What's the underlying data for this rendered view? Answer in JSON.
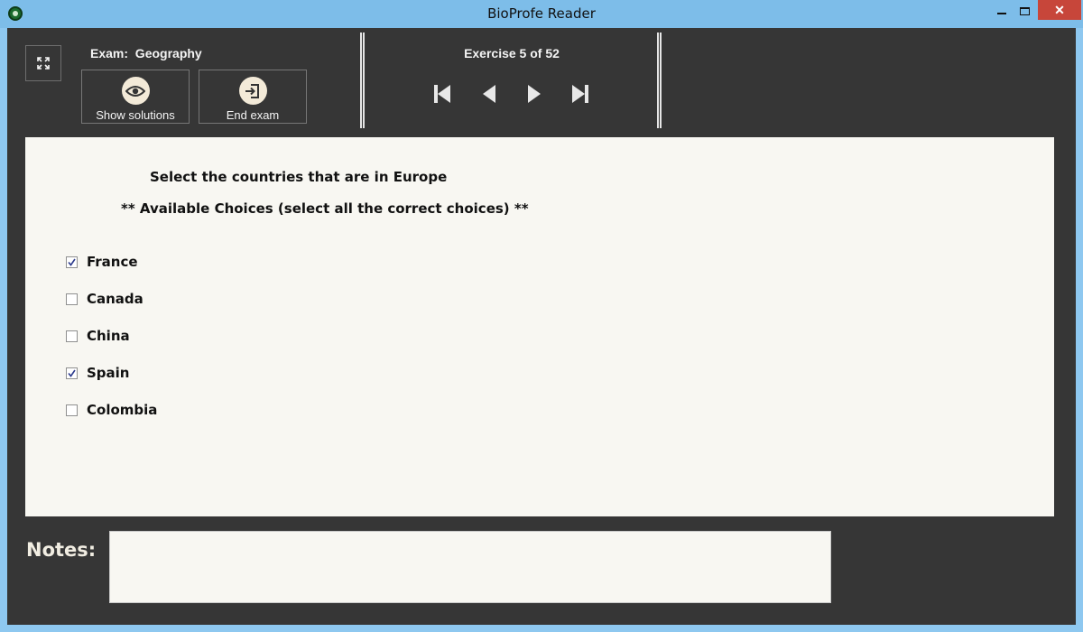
{
  "window": {
    "title": "BioProfe Reader",
    "close_glyph": "✕",
    "icons": [
      "app-icon",
      "minimize-icon",
      "maximize-icon",
      "close-icon"
    ]
  },
  "toolbar": {
    "exam_label": "Exam:  Geography",
    "show_solutions_label": "Show solutions",
    "end_exam_label": "End exam",
    "exercise_label": "Exercise 5 of 52",
    "icons": [
      "expand-icon",
      "eye-icon",
      "exit-door-icon",
      "first-icon",
      "prev-icon",
      "next-icon",
      "last-icon"
    ]
  },
  "question": {
    "title": "Select the countries that are in Europe",
    "instruction": "** Available Choices (select all the correct choices) **",
    "choices": [
      {
        "label": "France",
        "checked": true
      },
      {
        "label": "Canada",
        "checked": false
      },
      {
        "label": "China",
        "checked": false
      },
      {
        "label": "Spain",
        "checked": true
      },
      {
        "label": "Colombia",
        "checked": false
      }
    ]
  },
  "notes": {
    "label": "Notes:",
    "value": ""
  },
  "colors": {
    "title_bar": "#7dbde9",
    "client_bg": "#363636",
    "panel_bg": "#f8f7f2",
    "close_button": "#c7463a",
    "icon_circle": "#f3ead8",
    "check_mark": "#2b3a8c"
  }
}
